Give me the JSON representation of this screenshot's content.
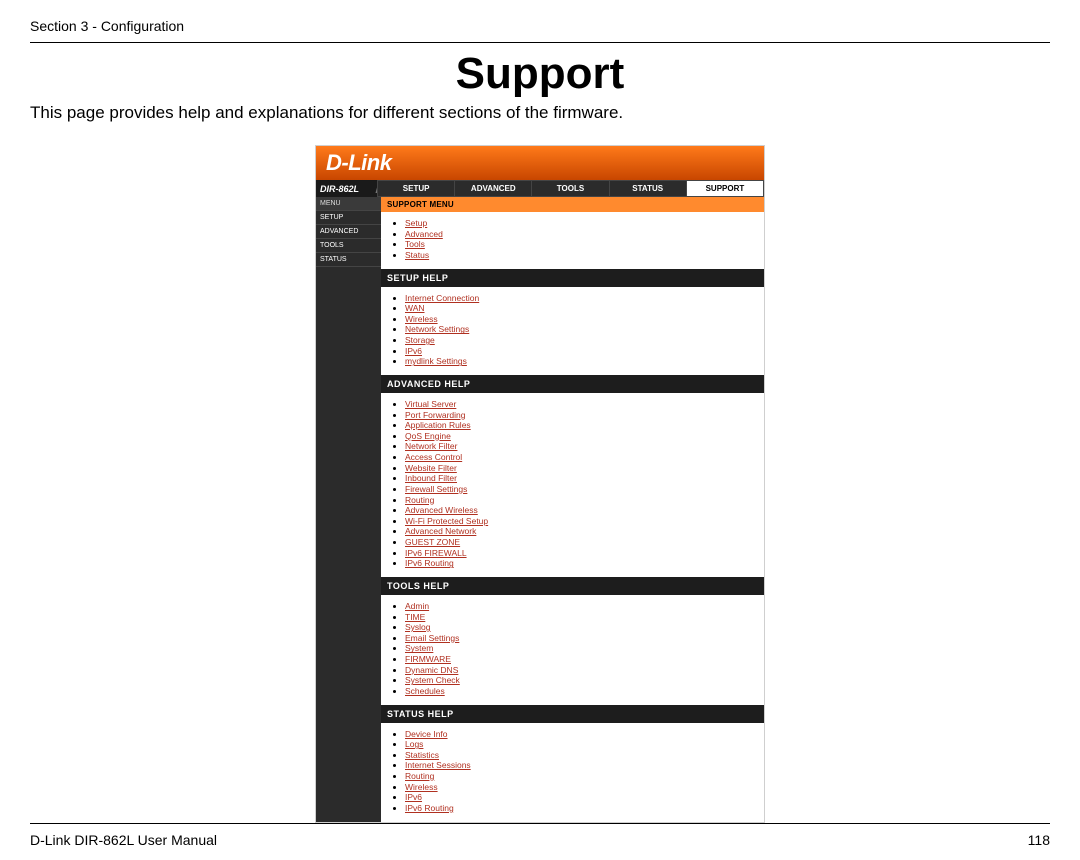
{
  "doc": {
    "section_label": "Section 3 - Configuration",
    "title": "Support",
    "description": "This page provides help and explanations for different sections of the firmware.",
    "footer_left": "D-Link DIR-862L User Manual",
    "footer_right": "118"
  },
  "router": {
    "brand": "D-Link",
    "model": "DIR-862L",
    "tabs": [
      "SETUP",
      "ADVANCED",
      "TOOLS",
      "STATUS",
      "SUPPORT"
    ],
    "active_tab": "SUPPORT",
    "sidebar": [
      "MENU",
      "SETUP",
      "ADVANCED",
      "TOOLS",
      "STATUS"
    ],
    "support_menu": {
      "heading": "SUPPORT MENU",
      "links": [
        "Setup",
        "Advanced",
        "Tools",
        "Status"
      ]
    },
    "sections": [
      {
        "heading": "SETUP HELP",
        "links": [
          "Internet Connection",
          "WAN",
          "Wireless",
          "Network Settings",
          "Storage",
          "IPv6",
          "mydlink Settings"
        ]
      },
      {
        "heading": "ADVANCED HELP",
        "links": [
          "Virtual Server",
          "Port Forwarding",
          "Application Rules",
          "QoS Engine",
          "Network Filter",
          "Access Control",
          "Website Filter",
          "Inbound Filter",
          "Firewall Settings",
          "Routing",
          "Advanced Wireless",
          "Wi-Fi Protected Setup",
          "Advanced Network",
          "GUEST ZONE",
          "IPv6 FIREWALL",
          "IPv6 Routing"
        ]
      },
      {
        "heading": "TOOLS HELP",
        "links": [
          "Admin",
          "TIME",
          "Syslog",
          "Email Settings",
          "System",
          "FIRMWARE",
          "Dynamic DNS",
          "System Check",
          "Schedules"
        ]
      },
      {
        "heading": "STATUS HELP",
        "links": [
          "Device Info",
          "Logs",
          "Statistics",
          "Internet Sessions",
          "Routing",
          "Wireless",
          "IPv6",
          "IPv6 Routing"
        ]
      }
    ]
  }
}
